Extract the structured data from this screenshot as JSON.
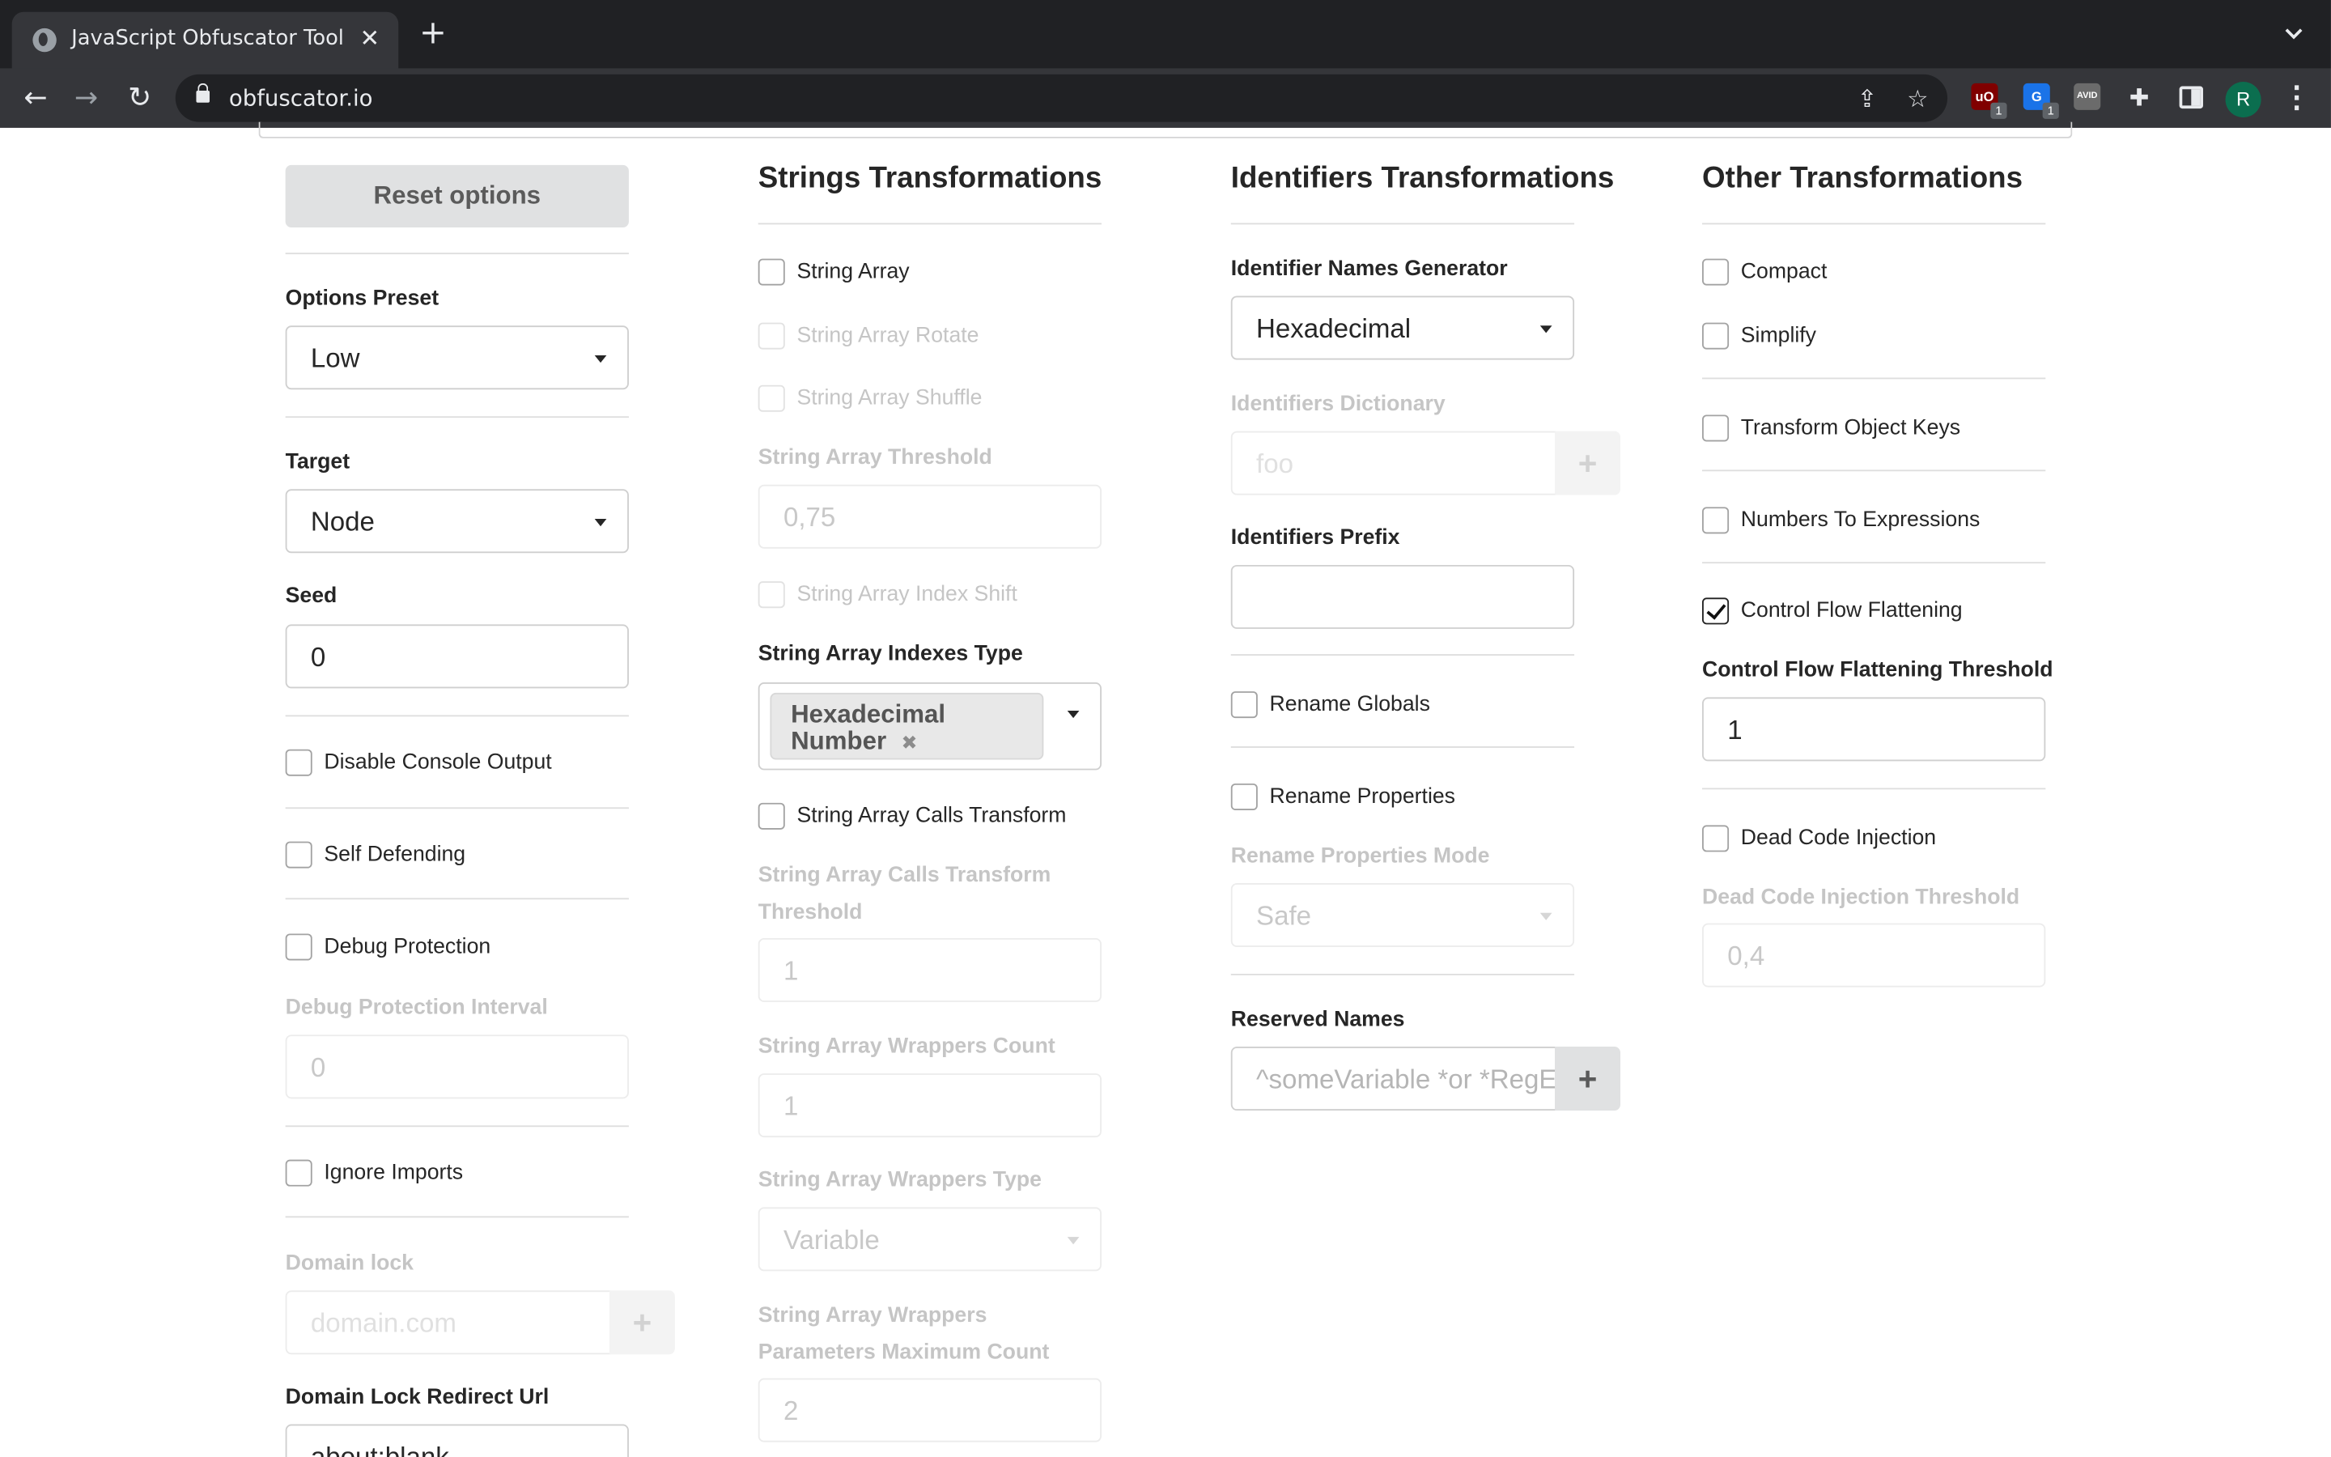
{
  "browser": {
    "tab_title": "JavaScript Obfuscator Tool",
    "url": "obfuscator.io",
    "extensions": [
      {
        "name": "ublock-origin",
        "color": "#800000",
        "label": "uO",
        "badge": "1"
      },
      {
        "name": "extension-blue",
        "color": "#1a73e8",
        "label": "G",
        "badge": "1"
      },
      {
        "name": "extension-avid",
        "color": "#6b6b6b",
        "label": "AVID",
        "badge": ""
      }
    ],
    "profile_initial": "R"
  },
  "col1": {
    "reset_button": "Reset options",
    "options_preset_label": "Options Preset",
    "options_preset_value": "Low",
    "target_label": "Target",
    "target_value": "Node",
    "seed_label": "Seed",
    "seed_value": "0",
    "disable_console_output": "Disable Console Output",
    "self_defending": "Self Defending",
    "debug_protection": "Debug Protection",
    "debug_protection_interval_label": "Debug Protection Interval",
    "debug_protection_interval_value": "0",
    "ignore_imports": "Ignore Imports",
    "domain_lock_label": "Domain lock",
    "domain_lock_placeholder": "domain.com",
    "domain_lock_redirect_label": "Domain Lock Redirect Url",
    "domain_lock_redirect_value": "about:blank"
  },
  "col2": {
    "title": "Strings Transformations",
    "string_array": "String Array",
    "string_array_rotate": "String Array Rotate",
    "string_array_shuffle": "String Array Shuffle",
    "string_array_threshold_label": "String Array Threshold",
    "string_array_threshold_value": "0,75",
    "string_array_index_shift": "String Array Index Shift",
    "indexes_type_label": "String Array Indexes Type",
    "indexes_type_chip_line1": "Hexadecimal",
    "indexes_type_chip_line2": "Number",
    "calls_transform": "String Array Calls Transform",
    "calls_transform_threshold_label": "String Array Calls Transform Threshold",
    "calls_transform_threshold_value": "1",
    "wrappers_count_label": "String Array Wrappers Count",
    "wrappers_count_value": "1",
    "wrappers_type_label": "String Array Wrappers Type",
    "wrappers_type_value": "Variable",
    "wrappers_params_label": "String Array Wrappers Parameters Maximum Count",
    "wrappers_params_value": "2"
  },
  "col3": {
    "title": "Identifiers Transformations",
    "names_generator_label": "Identifier Names Generator",
    "names_generator_value": "Hexadecimal",
    "dictionary_label": "Identifiers Dictionary",
    "dictionary_placeholder": "foo",
    "prefix_label": "Identifiers Prefix",
    "prefix_value": "",
    "rename_globals": "Rename Globals",
    "rename_properties": "Rename Properties",
    "rename_properties_mode_label": "Rename Properties Mode",
    "rename_properties_mode_value": "Safe",
    "reserved_names_label": "Reserved Names",
    "reserved_names_placeholder": "^someVariable *or *RegE"
  },
  "col4": {
    "title": "Other Transformations",
    "compact": "Compact",
    "simplify": "Simplify",
    "transform_object_keys": "Transform Object Keys",
    "numbers_to_expressions": "Numbers To Expressions",
    "control_flow_flattening": "Control Flow Flattening",
    "control_flow_flattening_checked": true,
    "cff_threshold_label": "Control Flow Flattening Threshold",
    "cff_threshold_value": "1",
    "dead_code_injection": "Dead Code Injection",
    "dead_code_threshold_label": "Dead Code Injection Threshold",
    "dead_code_threshold_value": "0,4"
  }
}
